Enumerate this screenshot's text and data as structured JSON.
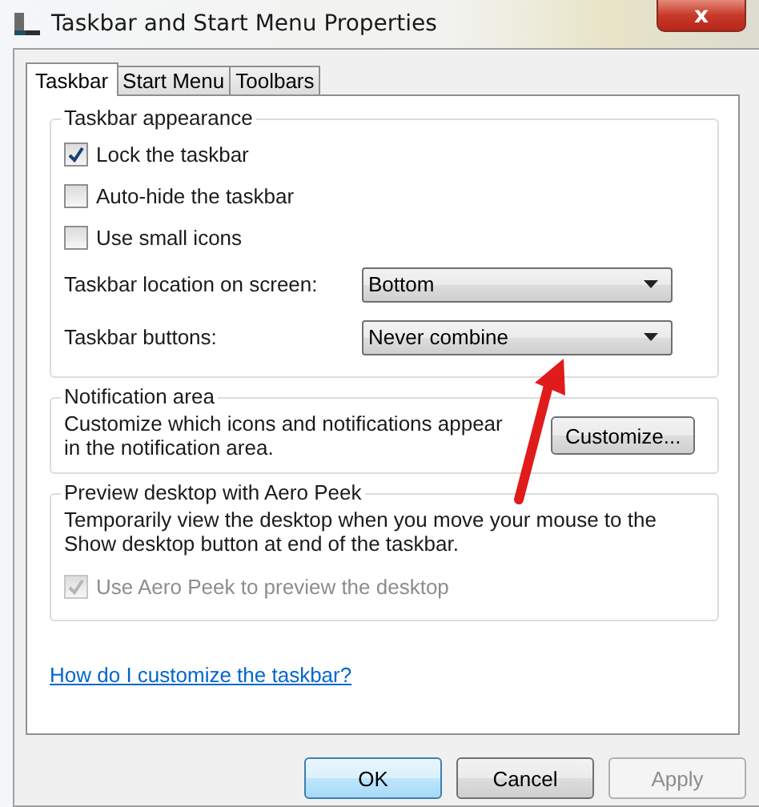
{
  "window": {
    "title": "Taskbar and Start Menu Properties",
    "close": "x"
  },
  "tabs": [
    {
      "label": "Taskbar",
      "selected": true
    },
    {
      "label": "Start Menu",
      "selected": false
    },
    {
      "label": "Toolbars",
      "selected": false
    }
  ],
  "groups": [
    {
      "title": "Taskbar appearance",
      "items": [
        {
          "kind": "checkbox",
          "label": "Lock the taskbar",
          "checked": true,
          "disabled": false
        },
        {
          "kind": "checkbox",
          "label": "Auto-hide the taskbar",
          "checked": false,
          "disabled": false
        },
        {
          "kind": "checkbox",
          "label": "Use small icons",
          "checked": false,
          "disabled": false
        },
        {
          "kind": "dropdown",
          "label": "Taskbar location on screen:",
          "value": "Bottom"
        },
        {
          "kind": "dropdown",
          "label": "Taskbar buttons:",
          "value": "Never combine"
        }
      ]
    },
    {
      "title": "Notification area",
      "items": [
        {
          "kind": "text_button",
          "text": "Customize which icons and notifications appear in the notification area.",
          "button": "Customize..."
        }
      ]
    },
    {
      "title": "Preview desktop with Aero Peek",
      "items": [
        {
          "kind": "text",
          "text": "Temporarily view the desktop when you move your mouse to the Show desktop button at end of the taskbar."
        },
        {
          "kind": "checkbox",
          "label": "Use Aero Peek to preview the desktop",
          "checked": true,
          "disabled": true
        }
      ]
    }
  ],
  "help_link": "How do I customize the taskbar?",
  "annotation": {
    "kind": "arrow"
  },
  "buttons": [
    {
      "label": "OK",
      "default": true,
      "disabled": false
    },
    {
      "label": "Cancel",
      "default": false,
      "disabled": false
    },
    {
      "label": "Apply",
      "default": false,
      "disabled": true
    }
  ]
}
